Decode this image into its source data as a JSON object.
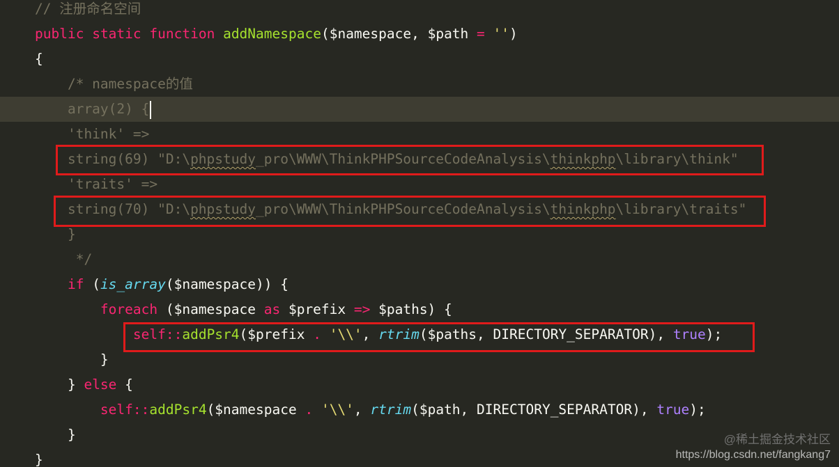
{
  "editor": {
    "theme_colors": {
      "background": "#272822",
      "line_highlight": "#3e3d32",
      "comment": "#75715e",
      "keyword": "#f92672",
      "function": "#a6e22e",
      "string": "#e6db74",
      "builtin": "#66d9ef",
      "constant": "#ae81ff",
      "plain": "#f8f8f2",
      "annotation_box": "#e01b1b"
    },
    "lines": [
      {
        "tokens": [
          {
            "t": "// 注册命名空间",
            "c": "comment"
          }
        ]
      },
      {
        "tokens": [
          {
            "t": "public",
            "c": "kw"
          },
          {
            "t": " ",
            "c": "plain"
          },
          {
            "t": "static",
            "c": "kw"
          },
          {
            "t": " ",
            "c": "plain"
          },
          {
            "t": "function",
            "c": "kw"
          },
          {
            "t": " ",
            "c": "plain"
          },
          {
            "t": "addNamespace",
            "c": "fn"
          },
          {
            "t": "($namespace, $path ",
            "c": "plain"
          },
          {
            "t": "=",
            "c": "kw"
          },
          {
            "t": " ",
            "c": "plain"
          },
          {
            "t": "''",
            "c": "str"
          },
          {
            "t": ")",
            "c": "plain"
          }
        ]
      },
      {
        "tokens": [
          {
            "t": "{",
            "c": "plain"
          }
        ]
      },
      {
        "tokens": [
          {
            "t": "    /* namespace的值",
            "c": "comment"
          }
        ]
      },
      {
        "highlight": true,
        "cursor": true,
        "tokens": [
          {
            "t": "    array(2) {",
            "c": "comment"
          }
        ]
      },
      {
        "tokens": [
          {
            "t": "    'think' =>",
            "c": "comment"
          }
        ]
      },
      {
        "tokens": [
          {
            "t": "    string(69) \"D:\\",
            "c": "comment"
          },
          {
            "t": "phpstudy",
            "c": "comment",
            "sq": true
          },
          {
            "t": "_pro\\WWW\\ThinkPHPSourceCodeAnalysis\\",
            "c": "comment"
          },
          {
            "t": "thinkphp",
            "c": "comment",
            "sq": true
          },
          {
            "t": "\\library\\think\"",
            "c": "comment"
          }
        ]
      },
      {
        "tokens": [
          {
            "t": "    'traits' =>",
            "c": "comment"
          }
        ]
      },
      {
        "tokens": [
          {
            "t": "    string(70) \"D:\\",
            "c": "comment"
          },
          {
            "t": "phpstudy",
            "c": "comment",
            "sq": true
          },
          {
            "t": "_pro\\WWW\\ThinkPHPSourceCodeAnalysis\\",
            "c": "comment"
          },
          {
            "t": "thinkphp",
            "c": "comment",
            "sq": true
          },
          {
            "t": "\\library\\traits\"",
            "c": "comment"
          }
        ]
      },
      {
        "tokens": [
          {
            "t": "    }",
            "c": "comment"
          }
        ]
      },
      {
        "tokens": [
          {
            "t": "     */",
            "c": "comment"
          }
        ]
      },
      {
        "tokens": [
          {
            "t": "    ",
            "c": "plain"
          },
          {
            "t": "if",
            "c": "kw"
          },
          {
            "t": " (",
            "c": "plain"
          },
          {
            "t": "is_array",
            "c": "builtin"
          },
          {
            "t": "($namespace)) {",
            "c": "plain"
          }
        ]
      },
      {
        "tokens": [
          {
            "t": "        ",
            "c": "plain"
          },
          {
            "t": "foreach",
            "c": "kw"
          },
          {
            "t": " ($namespace ",
            "c": "plain"
          },
          {
            "t": "as",
            "c": "kw"
          },
          {
            "t": " $prefix ",
            "c": "plain"
          },
          {
            "t": "=>",
            "c": "kw"
          },
          {
            "t": " $paths) {",
            "c": "plain"
          }
        ]
      },
      {
        "tokens": [
          {
            "t": "            ",
            "c": "plain"
          },
          {
            "t": "self",
            "c": "kw"
          },
          {
            "t": "::",
            "c": "kw"
          },
          {
            "t": "addPsr4",
            "c": "fn"
          },
          {
            "t": "($prefix ",
            "c": "plain"
          },
          {
            "t": ".",
            "c": "kw"
          },
          {
            "t": " ",
            "c": "plain"
          },
          {
            "t": "'\\\\'",
            "c": "str"
          },
          {
            "t": ", ",
            "c": "plain"
          },
          {
            "t": "rtrim",
            "c": "builtin"
          },
          {
            "t": "($paths, DIRECTORY_SEPARATOR), ",
            "c": "plain"
          },
          {
            "t": "true",
            "c": "const"
          },
          {
            "t": ");",
            "c": "plain"
          }
        ]
      },
      {
        "tokens": [
          {
            "t": "        }",
            "c": "plain"
          }
        ]
      },
      {
        "tokens": [
          {
            "t": "    } ",
            "c": "plain"
          },
          {
            "t": "else",
            "c": "kw"
          },
          {
            "t": " {",
            "c": "plain"
          }
        ]
      },
      {
        "tokens": [
          {
            "t": "        ",
            "c": "plain"
          },
          {
            "t": "self",
            "c": "kw"
          },
          {
            "t": "::",
            "c": "kw"
          },
          {
            "t": "addPsr4",
            "c": "fn"
          },
          {
            "t": "($namespace ",
            "c": "plain"
          },
          {
            "t": ".",
            "c": "kw"
          },
          {
            "t": " ",
            "c": "plain"
          },
          {
            "t": "'\\\\'",
            "c": "str"
          },
          {
            "t": ", ",
            "c": "plain"
          },
          {
            "t": "rtrim",
            "c": "builtin"
          },
          {
            "t": "($path, DIRECTORY_SEPARATOR), ",
            "c": "plain"
          },
          {
            "t": "true",
            "c": "const"
          },
          {
            "t": ");",
            "c": "plain"
          }
        ]
      },
      {
        "tokens": [
          {
            "t": "    }",
            "c": "plain"
          }
        ]
      },
      {
        "tokens": [
          {
            "t": "}",
            "c": "plain"
          }
        ]
      }
    ]
  },
  "watermark": {
    "site": "@稀土掘金技术社区",
    "url": "https://blog.csdn.net/fangkang7"
  }
}
